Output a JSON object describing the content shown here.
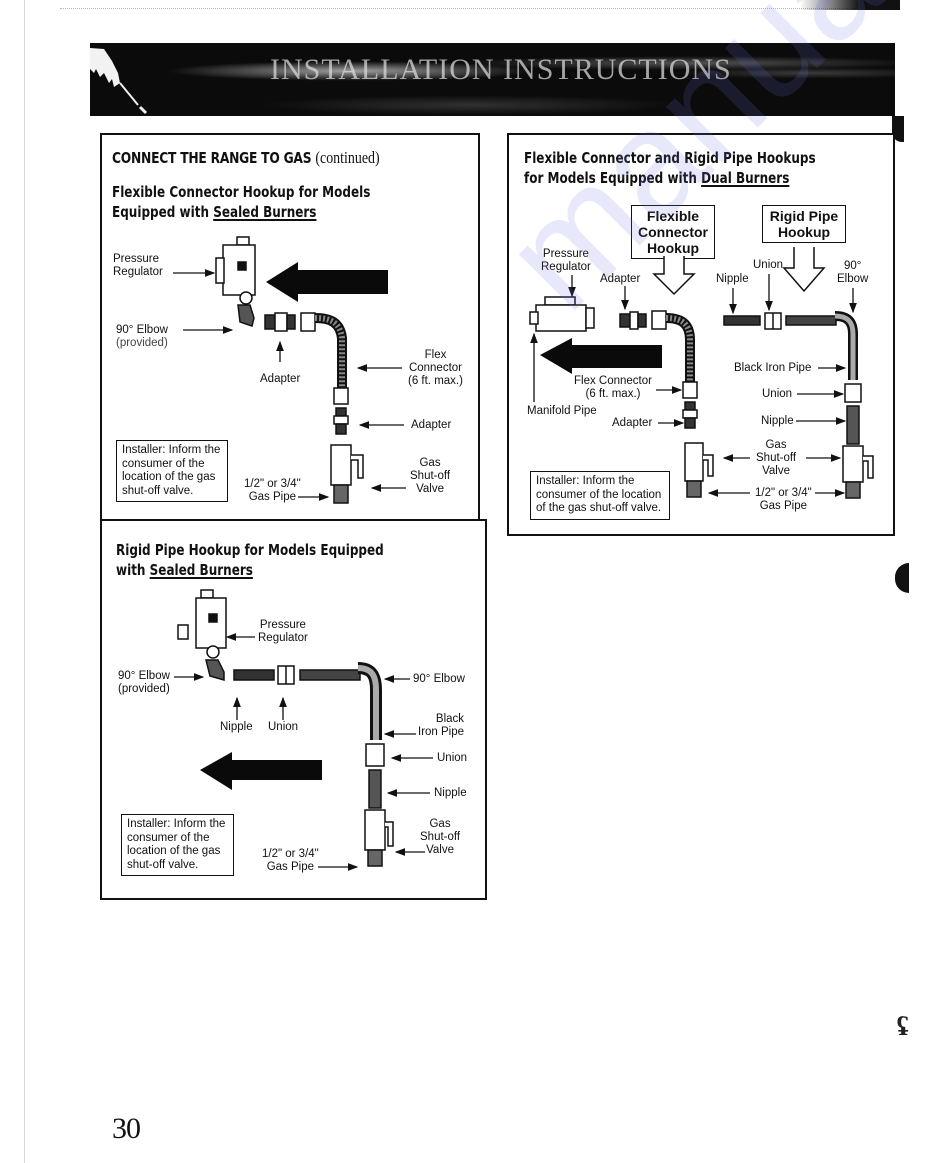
{
  "banner": {
    "title": "Installation Instructions",
    "icon": "hand-pointing-icon"
  },
  "panel_flex_sealed": {
    "section_heading": "CONNECT THE RANGE TO GAS",
    "section_heading_suffix": "(continued)",
    "title_line1": "Flexible Connector Hookup for Models",
    "title_line2_prefix": "Equipped with ",
    "title_line2_underlined": "Sealed Burners",
    "labels": {
      "pressure_regulator": "Pressure\nRegulator",
      "elbow": "90° Elbow",
      "elbow_note": "(provided)",
      "adapter_top": "Adapter",
      "flex_connector": "Flex\nConnector\n(6 ft. max.)",
      "adapter_right": "Adapter",
      "gas_shutoff_valve": "Gas\nShut-off\nValve",
      "gas_pipe": "1/2\" or 3/4\"\nGas Pipe"
    },
    "installer_note": "Installer: Inform the consumer of the location of the gas shut-off valve."
  },
  "panel_rigid_sealed": {
    "title_line1": "Rigid Pipe Hookup for Models Equipped",
    "title_line2_prefix": "with ",
    "title_line2_underlined": "Sealed Burners",
    "labels": {
      "pressure_regulator": "Pressure\nRegulator",
      "elbow_left": "90° Elbow",
      "elbow_left_note": "(provided)",
      "elbow_right": "90° Elbow",
      "nipple_bottom": "Nipple",
      "union_bottom": "Union",
      "black_iron_pipe": "Black\nIron Pipe",
      "union_right": "Union",
      "nipple_right": "Nipple",
      "gas_shutoff_valve": "Gas\nShut-off\nValve",
      "gas_pipe": "1/2\" or 3/4\"\nGas Pipe"
    },
    "installer_note": "Installer: Inform the consumer of the location of the gas shut-off valve."
  },
  "panel_dual": {
    "title_line1": "Flexible Connector and Rigid Pipe Hookups",
    "title_line2_prefix": "for Models Equipped with ",
    "title_line2_underlined": "Dual Burners",
    "box_flexible": "Flexible\nConnector\nHookup",
    "box_rigid": "Rigid Pipe\nHookup",
    "labels": {
      "pressure_regulator": "Pressure\nRegulator",
      "adapter_top": "Adapter",
      "nipple_top": "Nipple",
      "union_top": "Union",
      "elbow": "90°\nElbow",
      "manifold_pipe": "Manifold Pipe",
      "flex_connector": "Flex Connector\n(6 ft. max.)",
      "adapter_bottom": "Adapter",
      "black_iron_pipe": "Black Iron Pipe",
      "union_right": "Union",
      "nipple_right": "Nipple",
      "gas_shutoff_valve": "Gas\nShut-off\nValve",
      "gas_pipe": "1/2\" or 3/4\"\nGas Pipe"
    },
    "installer_note": "Installer: Inform the consumer of the location of the gas shut-off valve."
  },
  "page_number": "30"
}
